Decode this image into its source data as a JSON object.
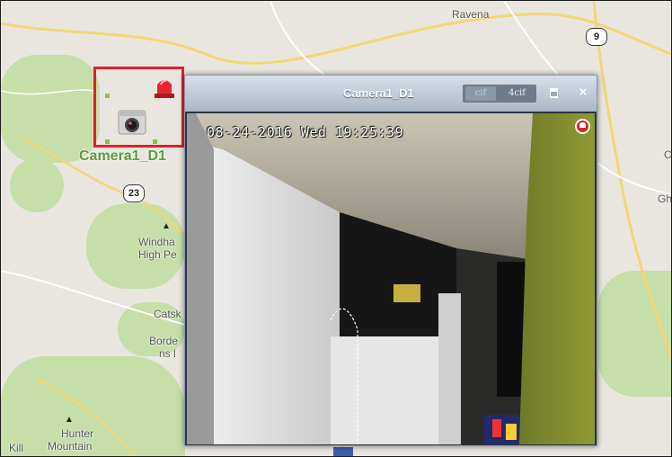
{
  "map": {
    "places": {
      "ravena": "Ravena",
      "windham_line1": "Windha",
      "windham_line2": "High Pe",
      "catskill": "Catsk",
      "borde_line1": "Borde",
      "borde_line2": "ns l",
      "hunter_line1": "Hunter",
      "hunter_line2": "Mountain",
      "kill": "Kill",
      "edge_c": "C",
      "edge_gh": "Gh"
    },
    "routes": {
      "r9": "9",
      "r23": "23"
    },
    "camera_label": "Camera1_D1",
    "camera_icon": "cctv-camera-icon",
    "alarm_icon": "red-siren-icon"
  },
  "window": {
    "title": "Camera1_D1",
    "buttons": {
      "cif": "cif",
      "four_cif": "4cif",
      "close": "×"
    },
    "maximize_icon": "maximize-icon",
    "timestamp": "08-24-2016 Wed 19:25:39",
    "video_alarm_icon": "alarm-bell-icon"
  },
  "colors": {
    "selection_border": "#e0202a",
    "label_green": "#5a9a3b",
    "titlebar": "#b4c2d1"
  }
}
